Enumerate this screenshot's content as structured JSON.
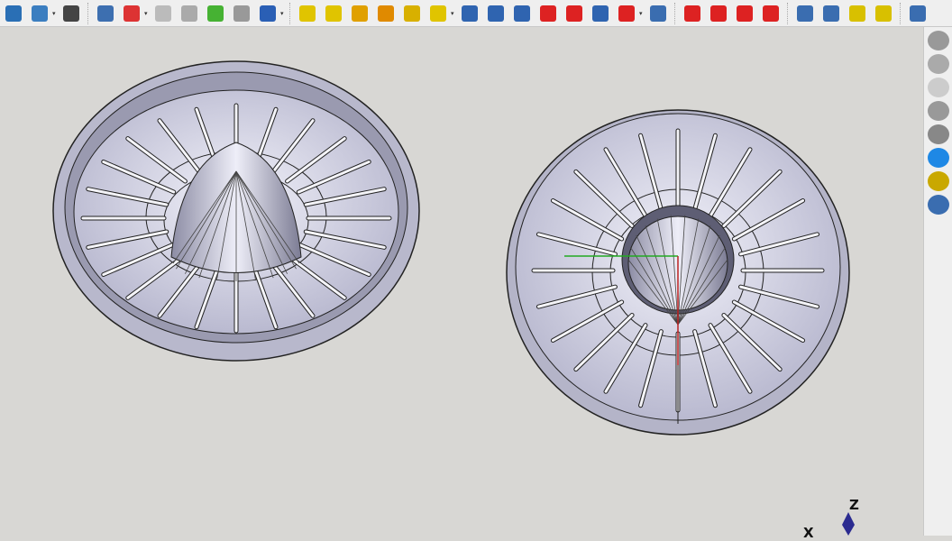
{
  "toolbar": {
    "groups": [
      [
        {
          "icon": "folder-icon",
          "color": "#2a6fb5"
        },
        {
          "icon": "export-icon",
          "color": "#3b7ec0",
          "dropdown": true
        },
        {
          "icon": "braces-icon",
          "color": "#444"
        }
      ],
      [
        {
          "icon": "part-icon",
          "color": "#3d6fb0"
        },
        {
          "icon": "sketch-icon",
          "color": "#d33",
          "dropdown": true
        },
        {
          "icon": "validate-sketch-icon",
          "color": "#bbb"
        },
        {
          "icon": "figure-icon",
          "color": "#aaa"
        },
        {
          "icon": "surface-icon",
          "color": "#46b233"
        },
        {
          "icon": "shape-binder-icon",
          "color": "#999"
        },
        {
          "icon": "datum-icon",
          "color": "#2a5fb5",
          "dropdown": true
        }
      ],
      [
        {
          "icon": "pad-icon",
          "color": "#e0c400"
        },
        {
          "icon": "revolution-icon",
          "color": "#e0c400"
        },
        {
          "icon": "additive-loft-icon",
          "color": "#e0a000"
        },
        {
          "icon": "additive-pipe-icon",
          "color": "#e08a00"
        },
        {
          "icon": "additive-helix-icon",
          "color": "#d8b000"
        },
        {
          "icon": "additive-primitive-icon",
          "color": "#e0c400",
          "dropdown": true
        },
        {
          "icon": "pocket-icon",
          "color": "#2f64b0"
        },
        {
          "icon": "hole-icon",
          "color": "#2f64b0"
        },
        {
          "icon": "groove-icon",
          "color": "#2f64b0"
        },
        {
          "icon": "subtractive-loft-icon",
          "color": "#d22"
        },
        {
          "icon": "subtractive-pipe-icon",
          "color": "#d22"
        },
        {
          "icon": "subtractive-helix-icon",
          "color": "#2f64b0"
        },
        {
          "icon": "subtractive-primitive-icon",
          "color": "#d22",
          "dropdown": true
        },
        {
          "icon": "boolean-icon",
          "color": "#3a6db0"
        }
      ],
      [
        {
          "icon": "fillet-icon",
          "color": "#d22"
        },
        {
          "icon": "chamfer-icon",
          "color": "#d22"
        },
        {
          "icon": "draft-icon",
          "color": "#d22"
        },
        {
          "icon": "thickness-icon",
          "color": "#d22"
        }
      ],
      [
        {
          "icon": "mirrored-icon",
          "color": "#3a6db0"
        },
        {
          "icon": "linear-pattern-icon",
          "color": "#3a6db0"
        },
        {
          "icon": "polar-pattern-icon",
          "color": "#d8c000"
        },
        {
          "icon": "multitransform-icon",
          "color": "#d8c000"
        }
      ],
      [
        {
          "icon": "sprocket-icon",
          "color": "#3a6db0"
        }
      ]
    ]
  },
  "sidebar": {
    "items": [
      {
        "icon": "appearance-icon"
      },
      {
        "icon": "material-icon"
      },
      {
        "icon": "transparency-icon"
      },
      {
        "icon": "group-icon"
      },
      {
        "icon": "box-icon"
      },
      {
        "icon": "info-icon"
      },
      {
        "icon": "macro-icon"
      },
      {
        "icon": "view-3d-icon"
      }
    ]
  },
  "axes": {
    "z_label": "Z",
    "x_label": "X"
  },
  "model": {
    "rib_count": 24,
    "colors": {
      "body": "#c6c6dc",
      "edge": "#1a1a1a",
      "x_axis": "#b22",
      "y_axis": "#2a2",
      "z_axis": "#228"
    }
  }
}
